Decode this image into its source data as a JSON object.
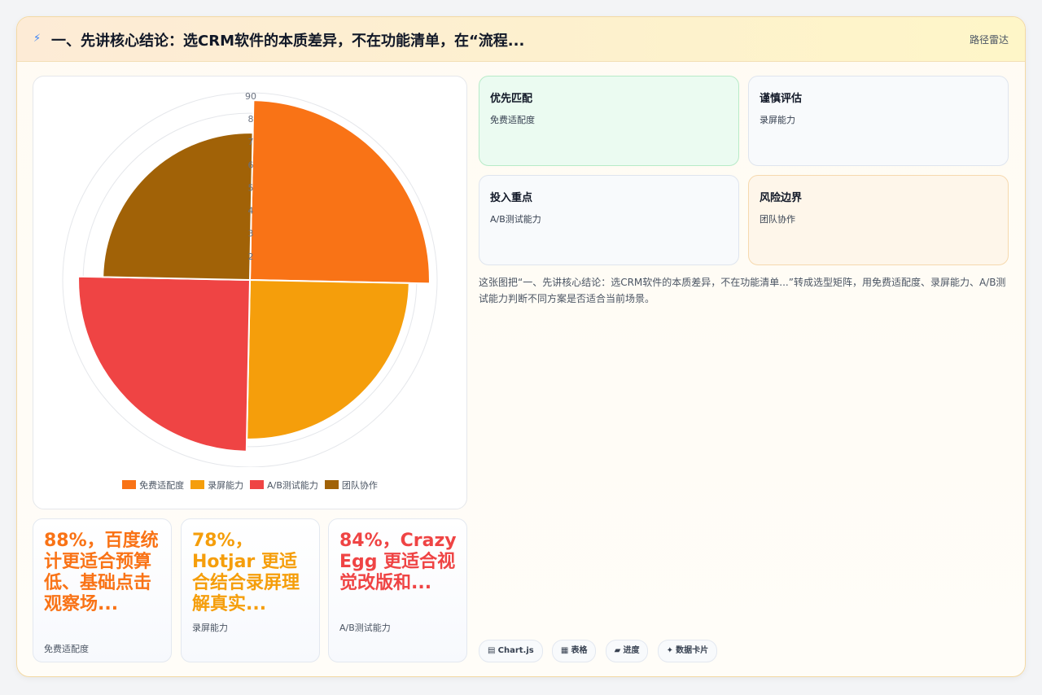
{
  "header": {
    "icon": "lightning-bolt-icon",
    "title": "一、先讲核心结论：选CRM软件的本质差异，不在功能清单，在“流程...",
    "tag": "路径雷达"
  },
  "chart_data": {
    "type": "polarArea",
    "categories": [
      "免费适配度",
      "录屏能力",
      "A/B测试能力",
      "团队协作"
    ],
    "values": [
      88,
      78,
      84,
      72
    ],
    "colors": [
      "#f97316",
      "#f59e0b",
      "#ef4444",
      "#a16207"
    ],
    "r_ticks": [
      "90",
      "8",
      "7",
      "6",
      "5",
      "4",
      "3",
      "2"
    ],
    "r_max": 90,
    "legend_position": "bottom"
  },
  "stats": [
    {
      "value": "88%，百度统计更适合预算低、基础点击观察场...",
      "label": "免费适配度",
      "color": "#f97316"
    },
    {
      "value": "78%，Hotjar 更适合结合录屏理解真实...",
      "label": "录屏能力",
      "color": "#f59e0b"
    },
    {
      "value": "84%，Crazy Egg 更适合视觉改版和...",
      "label": "A/B测试能力",
      "color": "#ef4444"
    }
  ],
  "quadrants": [
    {
      "title": "优先匹配",
      "subtitle": "免费适配度",
      "bg": "#ebfbf1",
      "border": "#b7ebc8"
    },
    {
      "title": "谨慎评估",
      "subtitle": "录屏能力",
      "bg": "#f8fafc",
      "border": "#dfe5ee"
    },
    {
      "title": "投入重点",
      "subtitle": "A/B测试能力",
      "bg": "#f8fafc",
      "border": "#dfe5ee"
    },
    {
      "title": "风险边界",
      "subtitle": "团队协作",
      "bg": "#fef6ea",
      "border": "#f6d9ae"
    }
  ],
  "description": "这张图把“一、先讲核心结论：选CRM软件的本质差异，不在功能清单...”转成选型矩阵，用免费适配度、录屏能力、A/B测试能力判断不同方案是否适合当前场景。",
  "chips": [
    {
      "icon": "chart-icon",
      "glyph": "▤",
      "label": "Chart.js"
    },
    {
      "icon": "table-icon",
      "glyph": "▦",
      "label": "表格"
    },
    {
      "icon": "progress-icon",
      "glyph": "▰",
      "label": "进度"
    },
    {
      "icon": "sparkle-icon",
      "glyph": "✦",
      "label": "数据卡片"
    }
  ]
}
